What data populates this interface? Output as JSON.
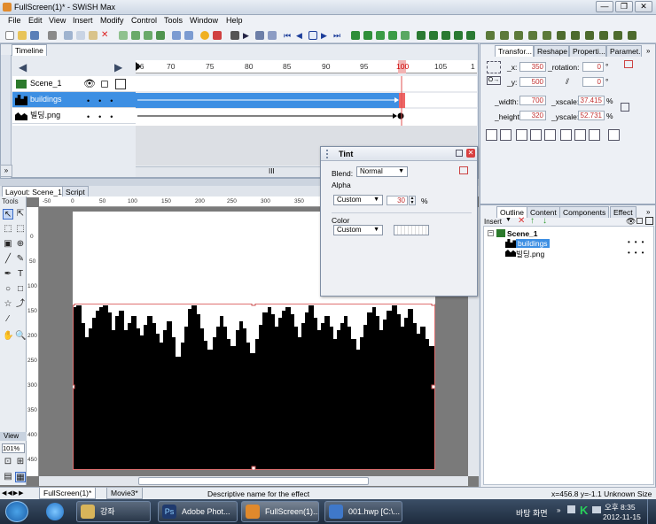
{
  "window": {
    "title": "FullScreen(1)* - SWiSH Max",
    "min": "—",
    "max": "❐",
    "close": "✕"
  },
  "menu": [
    "File",
    "Edit",
    "View",
    "Insert",
    "Modify",
    "Control",
    "Tools",
    "Window",
    "Help"
  ],
  "timeline": {
    "tab": "Timeline",
    "ticks": [
      "66",
      "70",
      "75",
      "80",
      "85",
      "90",
      "95",
      "100",
      "105",
      "1"
    ],
    "layers": [
      {
        "name": "Scene_1"
      },
      {
        "name": "buildings"
      },
      {
        "name": "빌딩.png"
      }
    ],
    "scroll_label": "III"
  },
  "layout": {
    "tabs": [
      "Layout: Scene_1",
      "Script"
    ],
    "tools_label": "Tools",
    "view_label": "View",
    "zoom": "101%",
    "h_ticks": [
      "-50",
      "0",
      "50",
      "100",
      "150",
      "200",
      "250",
      "300",
      "350",
      "400",
      "450"
    ],
    "v_ticks": [
      "0",
      "50",
      "100",
      "150",
      "200",
      "250",
      "300",
      "350",
      "400",
      "450",
      "500"
    ]
  },
  "tint": {
    "title": "Tint",
    "blend_label": "Blend:",
    "blend_value": "Normal",
    "alpha_label": "Alpha",
    "alpha_mode": "Custom",
    "alpha_value": "30",
    "alpha_unit": "%",
    "color_label": "Color",
    "color_mode": "Custom"
  },
  "transform": {
    "tabs": [
      "Transfor...",
      "Reshape",
      "Properti...",
      "Paramet..."
    ],
    "x_label": "_x:",
    "x": "350",
    "rotation_label": "_rotation:",
    "rotation": "0",
    "y_label": "_y:",
    "y": "500",
    "skew": "0",
    "deg": "°",
    "width_label": "_width:",
    "width": "700",
    "xscale_label": "_xscale:",
    "xscale": "37.415",
    "height_label": "_height:",
    "height": "320",
    "yscale_label": "_yscale:",
    "yscale": "52.731",
    "pct": "%"
  },
  "outline": {
    "tabs": [
      "Outline",
      "Content",
      "Components",
      "Effect"
    ],
    "insert": "Insert",
    "scene": "Scene_1",
    "items": [
      "buildings",
      "빌딩.png"
    ]
  },
  "tabs_bottom": [
    "FullScreen(1)*",
    "Movie3*"
  ],
  "status": {
    "hint": "Descriptive name for the effect",
    "coords": "x=456.8 y=-1.1 Unknown Size"
  },
  "taskbar": {
    "tasks": [
      "강좌",
      "Adobe Phot...",
      "FullScreen(1)...",
      "001.hwp [C:\\..."
    ],
    "desktop": "바탕 화면",
    "time": "오후 8:35",
    "date": "2012-11-15"
  }
}
